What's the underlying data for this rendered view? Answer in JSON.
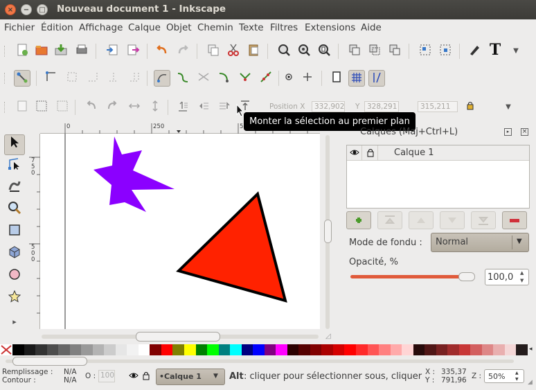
{
  "window": {
    "title": "Nouveau document 1 - Inkscape",
    "close_icon": "×",
    "min_icon": "−",
    "max_icon": "□"
  },
  "menu": [
    "Fichier",
    "Édition",
    "Affichage",
    "Calque",
    "Objet",
    "Chemin",
    "Texte",
    "Filtres",
    "Extensions",
    "Aide"
  ],
  "commands_bar": {
    "icons": [
      "new-document-icon",
      "open-icon",
      "save-icon",
      "print-icon",
      "import-icon",
      "export-icon",
      "undo-icon",
      "redo-icon",
      "copy-icon",
      "cut-icon",
      "paste-icon",
      "zoom-selection-icon",
      "zoom-drawing-icon",
      "zoom-page-icon",
      "duplicate-icon",
      "clone-icon",
      "unlink-clone-icon",
      "group-icon",
      "ungroup-icon",
      "fill-stroke-icon",
      "text-tool-icon",
      "overflow-arrow-icon"
    ]
  },
  "snap_bar": {
    "icons": [
      "snap-toggle-icon",
      "snap-bbox-icon",
      "snap-bbox-edge-icon",
      "snap-bbox-corner-icon",
      "snap-bbox-midpoint-icon",
      "snap-bbox-center-icon",
      "snap-nodes-icon",
      "snap-path-icon",
      "snap-intersection-icon",
      "snap-smooth-icon",
      "snap-midpoint-icon",
      "snap-center-icon",
      "snap-rotation-icon",
      "snap-page-icon",
      "snap-grid-icon",
      "snap-guide-icon"
    ]
  },
  "tool_controls": {
    "position_label": "Position X",
    "x_value": "332,902",
    "y_label": "Y",
    "y_value": "328,291",
    "w_value": "315,211",
    "lock_icon": "lock-icon",
    "overflow_arrow": "▼"
  },
  "tooltip": "Monter la sélection au premier plan",
  "toolbox": [
    "selector-tool",
    "node-tool",
    "tweak-tool",
    "zoom-tool",
    "rect-tool",
    "3dbox-tool",
    "ellipse-tool",
    "star-tool"
  ],
  "toolbox_more": "▸",
  "ruler": {
    "h_labels": [
      "0",
      "250",
      "500"
    ],
    "v_labels": [
      "7\n5\n0",
      "5\n0\n0"
    ]
  },
  "canvas_shapes": {
    "star_color": "#8b00ff",
    "triangle_color": "#ff2200"
  },
  "layers_panel": {
    "title": "Calques (Maj+Ctrl+L)",
    "layer_name": "Calque 1",
    "blend_label": "Mode de fondu :",
    "blend_value": "Normal",
    "opacity_label": "Opacité, %",
    "opacity_value": "100,0",
    "opacity_fraction": 1.0
  },
  "palette": {
    "colors": [
      "#000000",
      "#1a1a1a",
      "#333333",
      "#4d4d4d",
      "#666666",
      "#808080",
      "#999999",
      "#b3b3b3",
      "#cccccc",
      "#e6e6e6",
      "#f2f2f2",
      "#ffffff",
      "#800000",
      "#ff0000",
      "#808000",
      "#ffff00",
      "#008000",
      "#00ff00",
      "#008080",
      "#00ffff",
      "#000080",
      "#0000ff",
      "#800080",
      "#ff00ff",
      "#2b0000",
      "#550000",
      "#800000",
      "#aa0000",
      "#d40000",
      "#ff0000",
      "#ff2a2a",
      "#ff5555",
      "#ff8080",
      "#ffaaaa",
      "#ffd5d5",
      "#280b0b",
      "#501616",
      "#782121",
      "#a02c2c",
      "#c83737",
      "#d35f5f",
      "#de8787",
      "#e9afaf",
      "#f4d7d7",
      "#241c1c"
    ]
  },
  "status": {
    "fill_label": "Remplissage :",
    "fill_value": "N/A",
    "stroke_label": "Contour :",
    "stroke_value": "N/A",
    "o_label": "O :",
    "o_value": "100",
    "layer_selector": "•Calque 1",
    "message_bold": "Alt",
    "message": " : cliquer pour sélectionner sous, cliquer",
    "x_label": "X :",
    "x_value": "335,37",
    "y_label": "Y :",
    "y_value": "791,96",
    "z_label": "Z :",
    "zoom_value": "50%"
  }
}
